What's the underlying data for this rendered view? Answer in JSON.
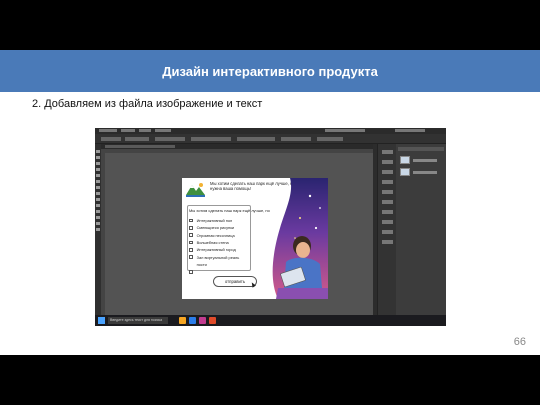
{
  "header": {
    "title": "Дизайн интерактивного продукта"
  },
  "subtitle": "2. Добавляем из файла изображение и текст",
  "page_number": "66",
  "screenshot": {
    "form": {
      "prompt": "Мы хотим сделать наш парк ещё лучше, но для этого нам нужна ваша помощь!",
      "question": "Мы хотим сделать наш парк ещё лучше, но",
      "options": [
        "Интерактивный пол",
        "Смеющиеся рисунки",
        "Огромная песочница",
        "Волшебная стена",
        "Интерактивный город",
        "Зал виртуальной реаль",
        "ности",
        ""
      ],
      "send_label": "отправить"
    },
    "taskbar": {
      "search_placeholder": "Введите здесь текст для поиска"
    },
    "colors": {
      "accent": "#4a7ab8",
      "app_bg": "#3a3a3a",
      "pasteboard": "#535353"
    }
  }
}
